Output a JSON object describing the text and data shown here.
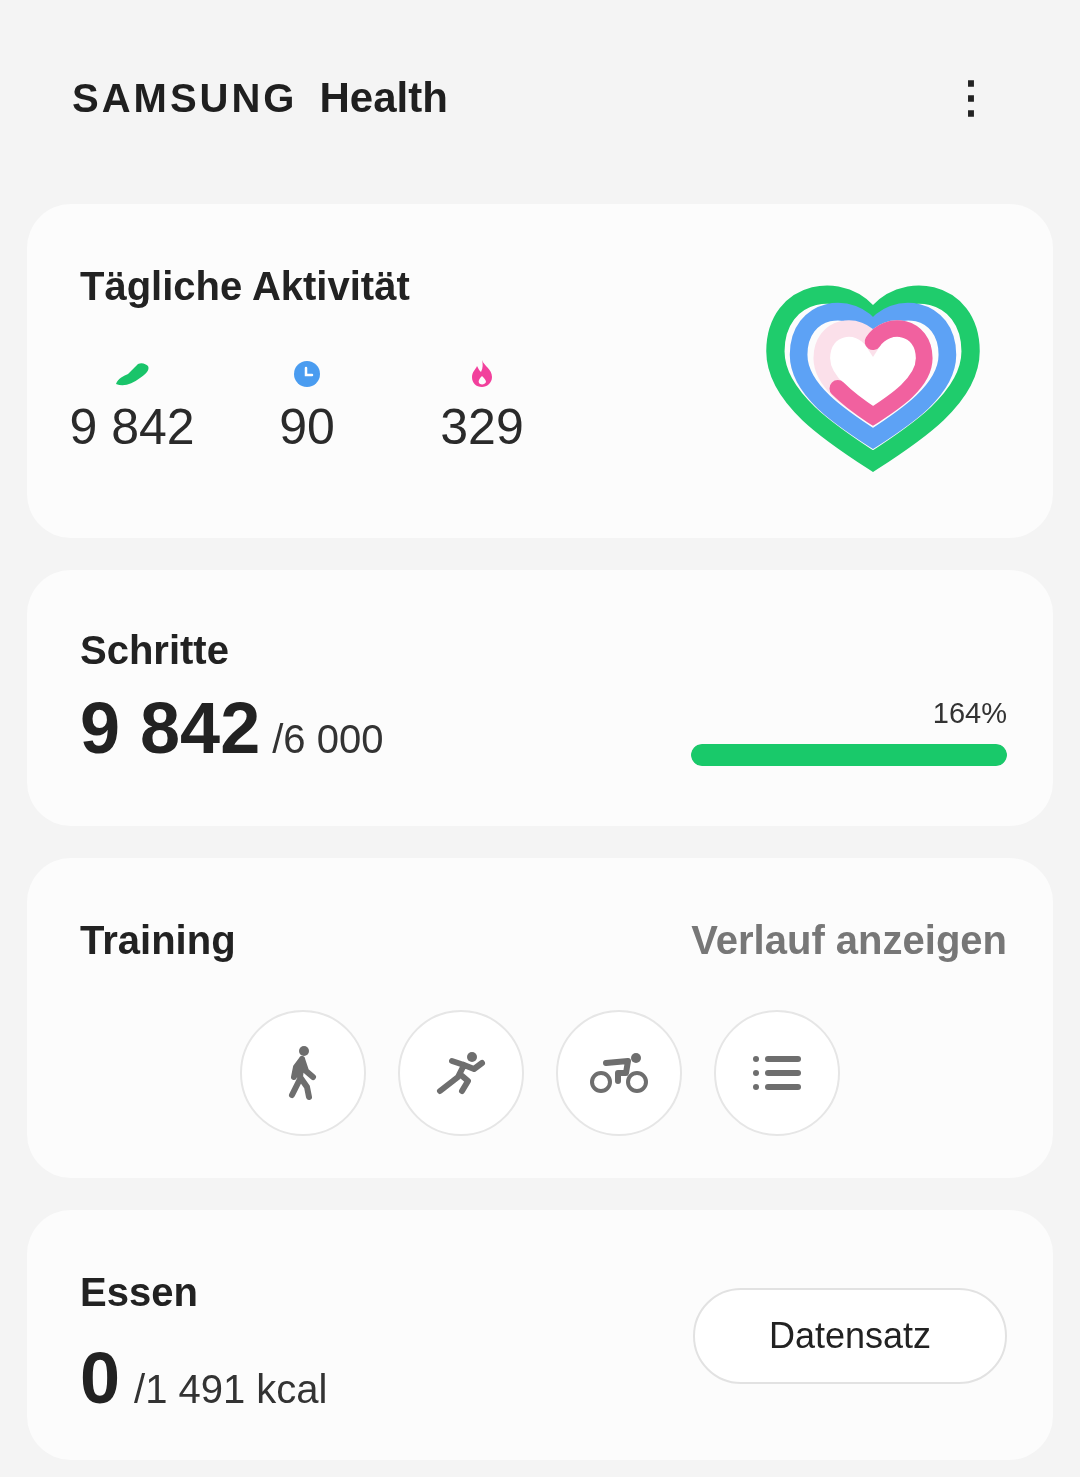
{
  "header": {
    "brand": "SAMSUNG",
    "product": "Health",
    "menu_icon": "⋮"
  },
  "daily_activity": {
    "title": "Tägliche Aktivität",
    "stats": [
      {
        "kind": "steps",
        "value": "9 842"
      },
      {
        "kind": "time",
        "value": "90"
      },
      {
        "kind": "calories",
        "value": "329"
      }
    ]
  },
  "steps": {
    "title": "Schritte",
    "value": "9 842",
    "goal": "/6 000",
    "percent": "164%",
    "level": 1
  },
  "training": {
    "title": "Training",
    "history_link": "Verlauf anzeigen",
    "buttons": [
      {
        "kind": "walk"
      },
      {
        "kind": "run"
      },
      {
        "kind": "cycle"
      },
      {
        "kind": "list"
      }
    ]
  },
  "food": {
    "title": "Essen",
    "value": "0",
    "goal": "/1 491 kcal",
    "button": "Datensatz"
  }
}
